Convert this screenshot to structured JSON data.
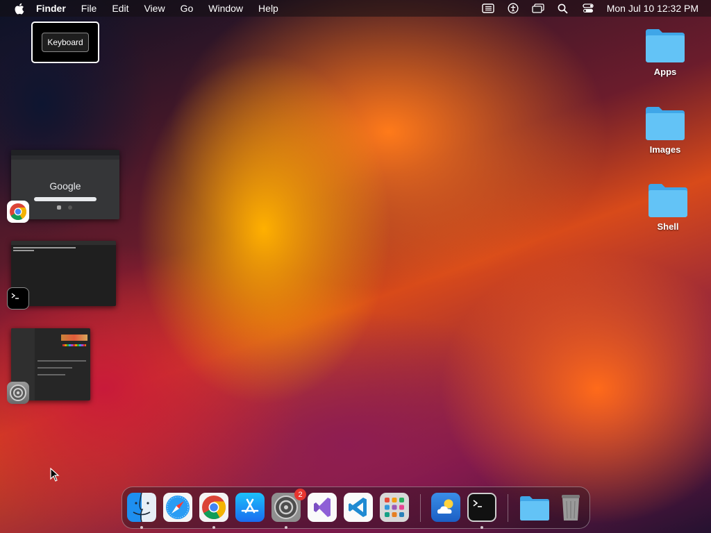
{
  "menubar": {
    "app_name": "Finder",
    "items": [
      "File",
      "Edit",
      "View",
      "Go",
      "Window",
      "Help"
    ],
    "clock": "Mon Jul 10  12:32 PM",
    "status_icons": [
      "list-icon",
      "accessibility-icon",
      "display-icon",
      "search-icon",
      "control-center-icon"
    ]
  },
  "keyboard_overlay": {
    "label": "Keyboard"
  },
  "desktop": {
    "folders": [
      {
        "label": "Apps"
      },
      {
        "label": "Images"
      },
      {
        "label": "Shell"
      }
    ]
  },
  "thumbnails": [
    {
      "app": "Google Chrome",
      "icon": "chrome-icon",
      "content_text": "Google"
    },
    {
      "app": "Terminal",
      "icon": "terminal-icon"
    },
    {
      "app": "System Settings",
      "icon": "settings-icon"
    }
  ],
  "dock": {
    "items": [
      {
        "name": "finder",
        "running": true
      },
      {
        "name": "safari",
        "running": false
      },
      {
        "name": "chrome",
        "running": true
      },
      {
        "name": "app-store",
        "running": false
      },
      {
        "name": "system-settings",
        "running": true,
        "badge": "2"
      },
      {
        "name": "visual-studio",
        "running": false
      },
      {
        "name": "vscode",
        "running": false
      },
      {
        "name": "launchpad",
        "running": false
      },
      {
        "name": "weather",
        "running": false
      },
      {
        "name": "terminal",
        "running": true
      },
      {
        "name": "folder",
        "running": false
      },
      {
        "name": "trash",
        "running": false
      }
    ],
    "badge_count": "2"
  },
  "colors": {
    "menubar_bg": "#140e12",
    "folder_blue": "#4fb3f2",
    "badge_red": "#e8352f"
  }
}
